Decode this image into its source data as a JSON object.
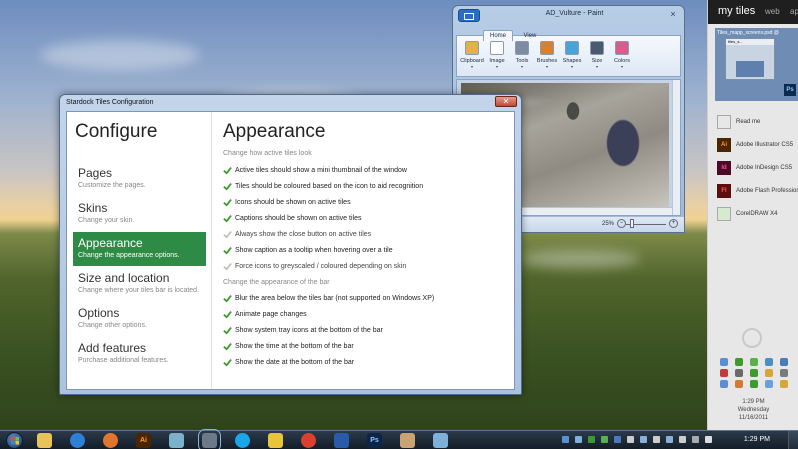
{
  "paint": {
    "title": "AD_Vulture - Paint",
    "tabs": [
      "Home",
      "View"
    ],
    "ribbon": [
      {
        "label": "Clipboard",
        "icon": "clipboard-icon",
        "color": "#e0b24a"
      },
      {
        "label": "Image",
        "icon": "image-icon",
        "color": "#ffffff"
      },
      {
        "label": "Tools",
        "icon": "pencil-icon",
        "color": "#7d8ca3"
      },
      {
        "label": "Brushes",
        "icon": "brush-icon",
        "color": "#d9802e"
      },
      {
        "label": "Shapes",
        "icon": "shapes-icon",
        "color": "#4aa3d9"
      },
      {
        "label": "Size",
        "icon": "line-size-icon",
        "color": "#4b5a6e"
      },
      {
        "label": "Colors",
        "icon": "palette-icon",
        "color": "#d95c8c"
      }
    ],
    "zoom": "25%"
  },
  "config": {
    "window_title": "Stardock Tiles Configuration",
    "close_glyph": "✕",
    "heading": "Configure",
    "nav": [
      {
        "label": "Pages",
        "desc": "Customize the pages.",
        "active": false
      },
      {
        "label": "Skins",
        "desc": "Change your skin.",
        "active": false
      },
      {
        "label": "Appearance",
        "desc": "Change the appearance options.",
        "active": true
      },
      {
        "label": "Size and location",
        "desc": "Change where your tiles bar is located.",
        "active": false
      },
      {
        "label": "Options",
        "desc": "Change other options.",
        "active": false
      },
      {
        "label": "Add features",
        "desc": "Purchase additional features.",
        "active": false
      }
    ],
    "panel_title": "Appearance",
    "section1": "Change how active tiles look",
    "options1": [
      {
        "label": "Active tiles should show a mini thumbnail of the window",
        "checked": true
      },
      {
        "label": "Tiles should be coloured based on the icon to aid recognition",
        "checked": true
      },
      {
        "label": "Icons should be shown on active tiles",
        "checked": true
      },
      {
        "label": "Captions should be shown on active tiles",
        "checked": true
      },
      {
        "label": "Always show the close button on active tiles",
        "checked": false
      },
      {
        "label": "Show caption as a tooltip when hovering over a tile",
        "checked": true
      },
      {
        "label": "Force icons to greyscaled / coloured depending on skin",
        "checked": false
      }
    ],
    "section2": "Change the appearance of the bar",
    "options2": [
      {
        "label": "Blur the area below the tiles bar (not supported on Windows XP)",
        "checked": true
      },
      {
        "label": "Animate page changes",
        "checked": true
      },
      {
        "label": "Show system tray icons at the bottom of the bar",
        "checked": true
      },
      {
        "label": "Show the time at the bottom of the bar",
        "checked": true
      },
      {
        "label": "Show the date at the bottom of the bar",
        "checked": true
      }
    ],
    "check_on_color": "#3c9a2e",
    "check_off_color": "#b8c9b5"
  },
  "tiles": {
    "tab_my": "my tiles",
    "tab_web": "web",
    "tab_ap": "ap",
    "preview_title": "Tiles_mapp_screens.psd @",
    "preview_inner": "tiles_s...",
    "preview_badge": "Ps",
    "items": [
      {
        "label": "Read me",
        "icon": "document-icon",
        "badge": "",
        "bg": "#e7e7e7",
        "fg": "#666666"
      },
      {
        "label": "Adobe Illustrator CS5",
        "icon": "illustrator-icon",
        "badge": "Ai",
        "bg": "#4b2500",
        "fg": "#ff9c34"
      },
      {
        "label": "Adobe InDesign CS5",
        "icon": "indesign-icon",
        "badge": "Id",
        "bg": "#4a0b26",
        "fg": "#ff4e9b"
      },
      {
        "label": "Adobe Flash Professional",
        "icon": "flash-icon",
        "badge": "Fl",
        "bg": "#5c0e0e",
        "fg": "#ff5a5a"
      },
      {
        "label": "CorelDRAW X4",
        "icon": "coreldraw-icon",
        "badge": "",
        "bg": "#d6ead2",
        "fg": "#3c9a2e"
      }
    ],
    "clock_time": "1:29 PM",
    "clock_day": "Wednesday",
    "clock_date": "11/16/2011",
    "tray_colors": [
      "#5a8fd6",
      "#3c9a2e",
      "#5ab04a",
      "#4d8fc4",
      "#4a7ab8",
      "#c33a3a",
      "#6a6a6a",
      "#3c9a2e",
      "#d8a53a",
      "#7a7a7a",
      "#5a8fd6",
      "#d27b2f",
      "#3c9a2e",
      "#6aa0d8",
      "#d8a53a"
    ]
  },
  "taskbar": {
    "icons": [
      {
        "name": "explorer-icon",
        "color": "#e7c35a"
      },
      {
        "name": "internet-explorer-icon",
        "color": "#2e7fd6"
      },
      {
        "name": "firefox-icon",
        "color": "#e0762e"
      },
      {
        "name": "illustrator-icon",
        "color": "#4b2500",
        "badge": "Ai"
      },
      {
        "name": "network-icon",
        "color": "#7cb2c9"
      },
      {
        "name": "game-icon",
        "color": "#6b7a88",
        "selected": true
      },
      {
        "name": "skype-icon",
        "color": "#1aa6e8"
      },
      {
        "name": "messenger-icon",
        "color": "#e8c43a"
      },
      {
        "name": "chrome-icon",
        "color": "#d8412f"
      },
      {
        "name": "word-icon",
        "color": "#2a5ba9"
      },
      {
        "name": "photoshop-icon",
        "color": "#0b2547",
        "badge": "Ps"
      },
      {
        "name": "paint-icon",
        "color": "#c9a372"
      },
      {
        "name": "palette-icon",
        "color": "#7fb0d8"
      }
    ],
    "tray_colors": [
      "#5a8fd6",
      "#7fb0d8",
      "#3c9a2e",
      "#5ab04a",
      "#4a7ab8",
      "#cccccc",
      "#8ab0d8",
      "#cccccc",
      "#8ab0d8",
      "#cccccc",
      "#aaaaaa",
      "#dddddd"
    ],
    "time": "1:29 PM"
  }
}
